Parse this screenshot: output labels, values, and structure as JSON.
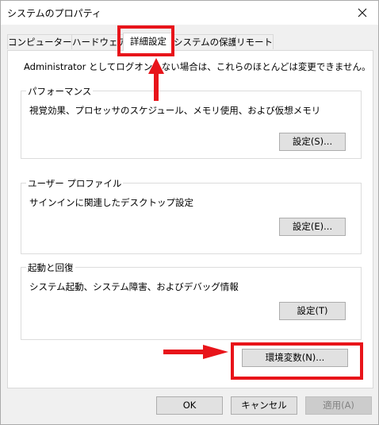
{
  "window": {
    "title": "システムのプロパティ"
  },
  "tabs": [
    {
      "label": "コンピューター名",
      "active": false
    },
    {
      "label": "ハードウェア",
      "active": false
    },
    {
      "label": "詳細設定",
      "active": true
    },
    {
      "label": "システムの保護",
      "active": false
    },
    {
      "label": "リモート",
      "active": false
    }
  ],
  "panel": {
    "note": "Administrator としてログオンしない場合は、これらのほとんどは変更できません。",
    "performance": {
      "legend": "パフォーマンス",
      "description": "視覚効果、プロセッサのスケジュール、メモリ使用、および仮想メモリ",
      "button": "設定(S)..."
    },
    "user_profile": {
      "legend": "ユーザー プロファイル",
      "description": "サインインに関連したデスクトップ設定",
      "button": "設定(E)..."
    },
    "startup": {
      "legend": "起動と回復",
      "description": "システム起動、システム障害、およびデバッグ情報",
      "button": "設定(T)"
    },
    "env_button": "環境変数(N)..."
  },
  "footer": {
    "ok": "OK",
    "cancel": "キャンセル",
    "apply": "適用(A)"
  },
  "colors": {
    "annotation": "#e8141a"
  },
  "icons": {
    "close": "close-icon",
    "arrow_up": "arrow-up-icon",
    "arrow_right": "arrow-right-icon"
  }
}
